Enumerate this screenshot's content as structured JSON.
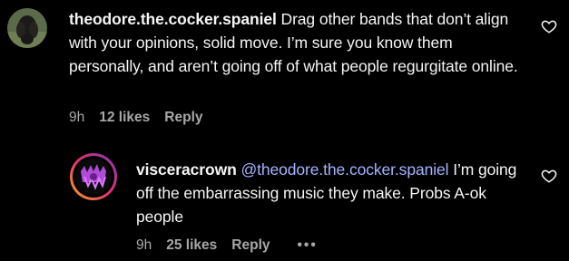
{
  "comments": [
    {
      "username": "theodore.the.cocker.spaniel",
      "text": " Drag other bands that don’t align with your opinions, solid move. I’m sure you know them personally, and aren’t going off of what people regurgitate online.",
      "time": "9h",
      "likes": "12 likes",
      "reply_label": "Reply"
    },
    {
      "username": "visceracrown",
      "mention": "@theodore.the.cocker.spaniel",
      "text": " I’m going off the embarrassing music they make. Probs A-ok people",
      "time": "9h",
      "likes": "25 likes",
      "reply_label": "Reply",
      "more_label": "•••"
    }
  ],
  "icons": {
    "like": "heart-outline-icon",
    "more": "more-options-icon"
  },
  "colors": {
    "background": "#000000",
    "text": "#f5f5f5",
    "meta": "#a8a8a8",
    "mention": "#a6b3ff",
    "story_ring": "#c13584"
  }
}
